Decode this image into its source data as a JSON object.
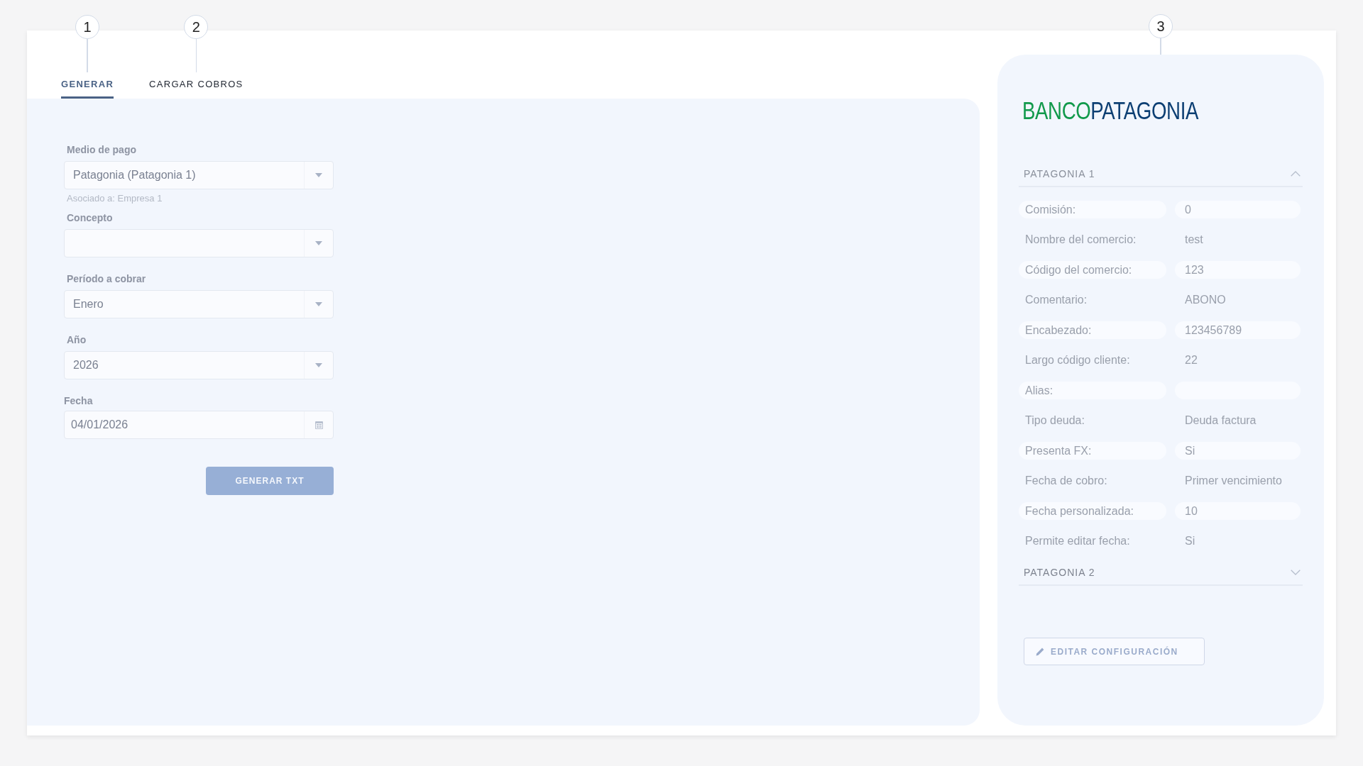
{
  "tabs": [
    {
      "label": "GENERAR",
      "selected": true,
      "callout": "1"
    },
    {
      "label": "CARGAR COBROS",
      "selected": false,
      "callout": "2"
    }
  ],
  "form": {
    "fields": [
      {
        "kind": "select",
        "label": "Medio de pago",
        "value": "Patagonia (Patagonia 1)",
        "hint": "Asociado a: Empresa 1"
      },
      {
        "kind": "select",
        "label": "Concepto"
      },
      {
        "kind": "select",
        "label": "Período a cobrar",
        "value": "Enero"
      },
      {
        "kind": "select",
        "label": "Año",
        "value": "2026"
      },
      {
        "kind": "date",
        "label": "Fecha",
        "value": "04/01/2026"
      }
    ],
    "submit": {
      "label": "GENERAR TXT",
      "disabled": true
    }
  },
  "bank": {
    "callout": "3",
    "logo": [
      "BANCO",
      "PATAGONIA"
    ],
    "sections": [
      {
        "title": "PATAGONIA 1",
        "expanded": true,
        "rows": [
          {
            "label": "Comisión:",
            "value": "0"
          },
          {
            "label": "Nombre del comercio:",
            "value": "test"
          },
          {
            "label": "Código del comercio:",
            "value": "123"
          },
          {
            "label": "Comentario:",
            "value": "ABONO"
          },
          {
            "label": "Encabezado:",
            "value": "123456789"
          },
          {
            "label": "Largo código cliente:",
            "value": "22"
          },
          {
            "label": "Alias:"
          },
          {
            "label": "Tipo deuda:",
            "value": "Deuda factura"
          },
          {
            "label": "Presenta FX:",
            "value": "Si"
          },
          {
            "label": "Fecha de cobro:",
            "value": "Primer vencimiento"
          },
          {
            "label": "Fecha personalizada:",
            "value": "10"
          },
          {
            "label": "Permite editar fecha:",
            "value": "Si"
          }
        ]
      },
      {
        "title": "PATAGONIA 2",
        "expanded": false
      }
    ],
    "edit_button": "EDITAR CONFIGURACIÓN"
  }
}
